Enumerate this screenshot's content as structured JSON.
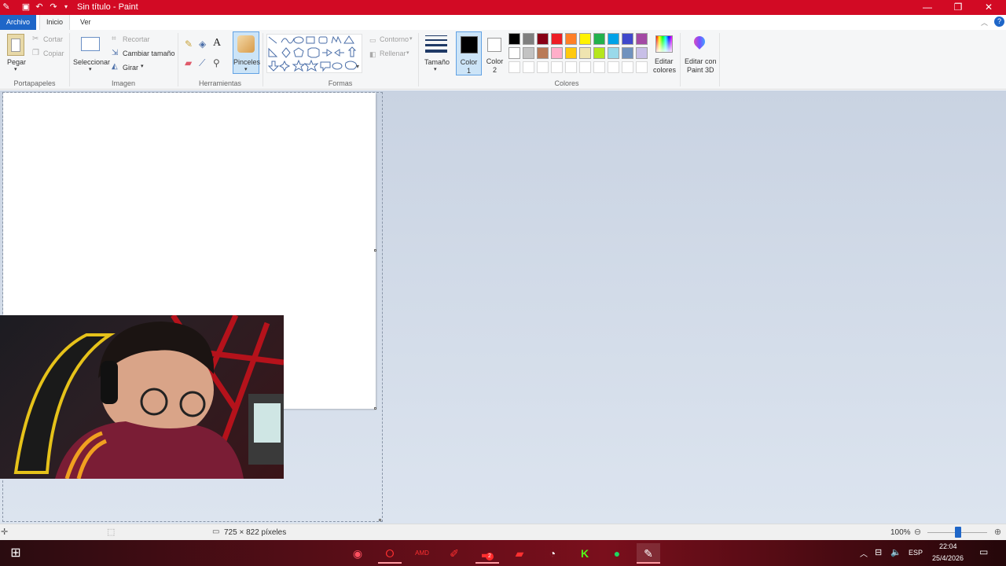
{
  "window": {
    "title": "Sin título - Paint",
    "titlebar_color": "#d20a24"
  },
  "tabs": [
    {
      "label": "Archivo"
    },
    {
      "label": "Inicio"
    },
    {
      "label": "Ver"
    }
  ],
  "ribbon": {
    "clipboard": {
      "paste_label": "Pegar",
      "cut_label": "Cortar",
      "copy_label": "Copiar",
      "group_label": "Portapapeles"
    },
    "image": {
      "select_label": "Seleccionar",
      "crop_label": "Recortar",
      "resize_label": "Cambiar tamaño",
      "rotate_label": "Girar",
      "group_label": "Imagen"
    },
    "tools": {
      "brushes_label": "Pinceles",
      "group_label": "Herramientas"
    },
    "shapes": {
      "outline_label": "Contorno",
      "fill_label": "Rellenar",
      "group_label": "Formas"
    },
    "size_label": "Tamaño",
    "color1_label": "Color",
    "color1_num": "1",
    "color2_label": "Color",
    "color2_num": "2",
    "colors": {
      "group_label": "Colores",
      "edit_colors_label_1": "Editar",
      "edit_colors_label_2": "colores",
      "palette_row1": [
        "#000000",
        "#7f7f7f",
        "#880015",
        "#ed1c24",
        "#ff7f27",
        "#fff200",
        "#22b14c",
        "#00a2e8",
        "#3f48cc",
        "#a349a4"
      ],
      "palette_row2": [
        "#ffffff",
        "#c3c3c3",
        "#b97a57",
        "#ffaec9",
        "#ffc90e",
        "#efe4b0",
        "#b5e61d",
        "#99d9ea",
        "#7092be",
        "#c8bfe7"
      ]
    },
    "paint3d_label_1": "Editar con",
    "paint3d_label_2": "Paint 3D"
  },
  "status": {
    "dimensions": "725 × 822 píxeles",
    "zoom": "100%"
  },
  "taskbar": {
    "lang": "ESP",
    "time": "22:04",
    "date": "25/4/2026",
    "badge": "2"
  }
}
